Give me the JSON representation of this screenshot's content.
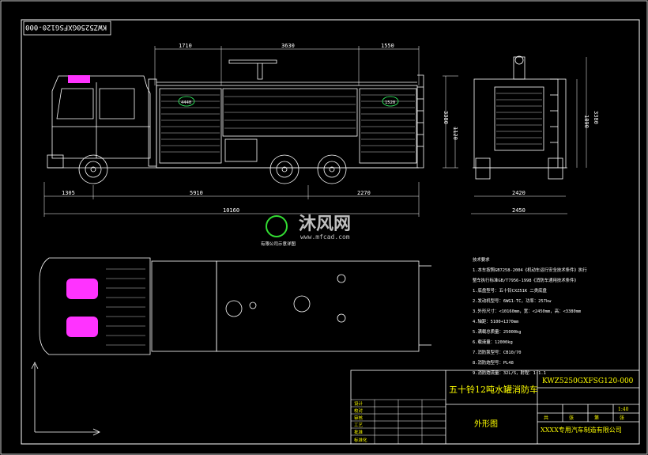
{
  "drawing": {
    "code_stamp": "KWZ5250GXFSG120-000",
    "side_view": {
      "top_dims": [
        "1710",
        "3630",
        "1550"
      ],
      "bottom_dims": [
        "1305",
        "5910",
        "2270"
      ],
      "overall_length": "10160",
      "height_dims": [
        "1120",
        "3380"
      ],
      "body_tags": [
        "4440",
        "1520"
      ]
    },
    "rear_view": {
      "width_dims": [
        "2420",
        "2450"
      ],
      "height_dims": [
        "1890",
        "3380"
      ]
    },
    "watermark": {
      "site_name": "沐风网",
      "url": "www.mfcad.com",
      "caption": "有限公司示意详图"
    },
    "tech_notes": {
      "heading": "技术要求",
      "lines": [
        "1.本车按照GB7258-2004《机动车运行安全技术条件》执行",
        "整车执行标准GB/T7956-1998《消防车通用技术条件》",
        "1.底盘型号：五十铃CXZ51K 二类底盘",
        "2.发动机型号：6WG1-TC，功率：257kw",
        "3.外形尺寸：<10160mm，宽：<2450mm，高：<3380mm",
        "4.轴距：5100+1370mm",
        "5.满载总质量：25000kg",
        "6.载液量：12000kg",
        "7.消防泵型号：CB10/70",
        "8.消防炮型号：PL48",
        "9.消防炮流量：32L/S，射程：1:1.1"
      ]
    },
    "title_block": {
      "product_name": "五十铃12吨水罐消防车",
      "drawing_no": "KWZ5250GXFSG120-000",
      "view_name": "外形图",
      "scale": "1:40",
      "company": "XXXX专用汽车制造有限公司",
      "left_labels": [
        "设计",
        "校对",
        "审核",
        "工艺",
        "批准",
        "标准化"
      ],
      "right_row_labels": [
        "共",
        "张",
        "第",
        "张"
      ]
    }
  }
}
